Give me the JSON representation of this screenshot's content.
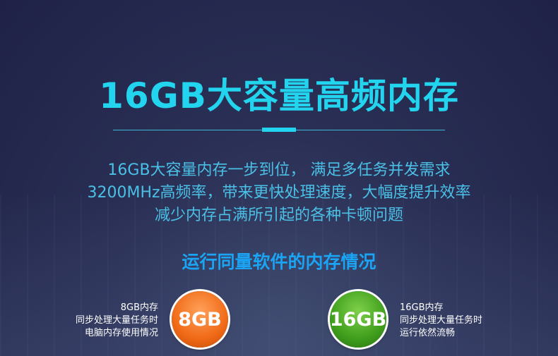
{
  "title": "16GB大容量高频内存",
  "description": {
    "line1": "16GB大容量内存一步到位， 满足多任务并发需求",
    "line2": "3200MHz高频率，带来更快处理速度，大幅度提升效率",
    "line3": "减少内存占满所引起的各种卡顿问题"
  },
  "subtitle": "运行同量软件的内存情况",
  "comparison": {
    "left": {
      "badge": "8GB",
      "caption_line1": "8GB内存",
      "caption_line2": "同步处理大量任务时",
      "caption_line3": "电脑内存使用情况",
      "color": "#f06a17"
    },
    "right": {
      "badge": "16GB",
      "caption_line1": "16GB内存",
      "caption_line2": "同步处理大量任务时",
      "caption_line3": "运行依然流畅",
      "color": "#3f9e1c"
    }
  },
  "colors": {
    "title": "#23d4ef",
    "description": "#4bc0e6",
    "subtitle": "#1aa4f3",
    "background": "#2a2f55"
  }
}
